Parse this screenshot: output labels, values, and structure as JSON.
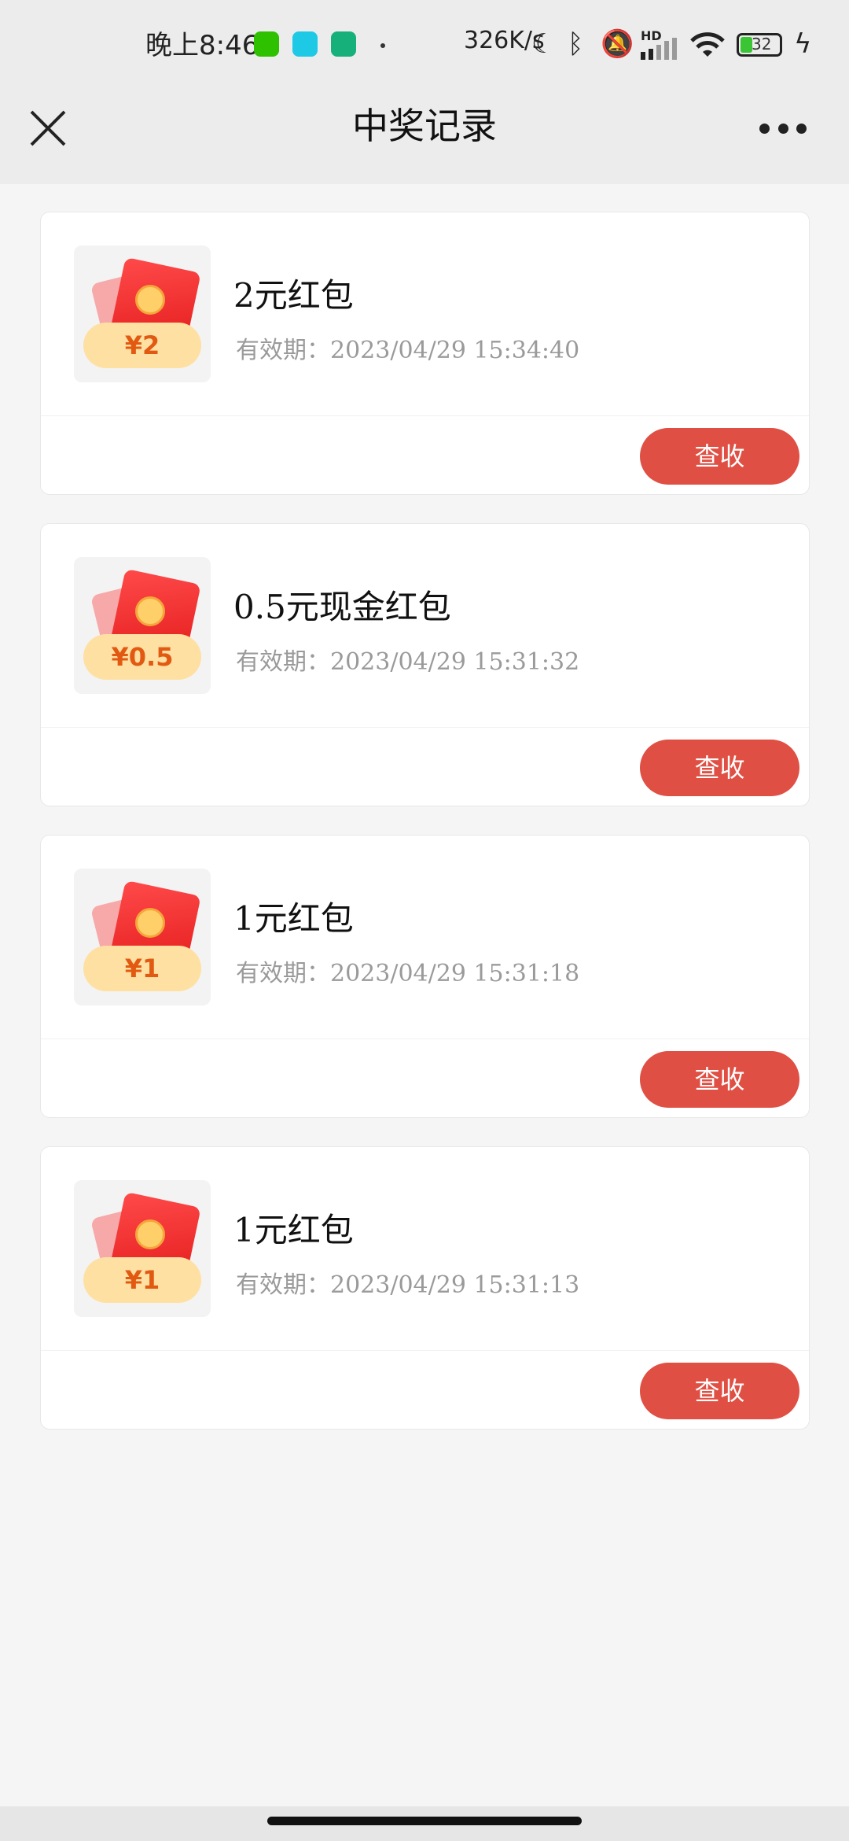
{
  "status_bar": {
    "time": "晚上8:46",
    "net_speed": "326K/s",
    "battery_level": "32",
    "signal_label": "HD",
    "apps": [
      "wechat-icon",
      "qq-icon",
      "shield-icon"
    ]
  },
  "nav": {
    "title": "中奖记录"
  },
  "records": [
    {
      "amount": "¥2",
      "name": "2元红包",
      "expiry": "有效期：2023/04/29 15:34:40",
      "button": "查收"
    },
    {
      "amount": "¥0.5",
      "name": "0.5元现金红包",
      "expiry": "有效期：2023/04/29 15:31:32",
      "button": "查收"
    },
    {
      "amount": "¥1",
      "name": "1元红包",
      "expiry": "有效期：2023/04/29 15:31:18",
      "button": "查收"
    },
    {
      "amount": "¥1",
      "name": "1元红包",
      "expiry": "有效期：2023/04/29 15:31:13",
      "button": "查收"
    }
  ],
  "colors": {
    "accent": "#e04f43",
    "amount_text": "#e25a12",
    "amount_pill": "#ffe0a3",
    "page_bg": "#f5f5f5"
  }
}
